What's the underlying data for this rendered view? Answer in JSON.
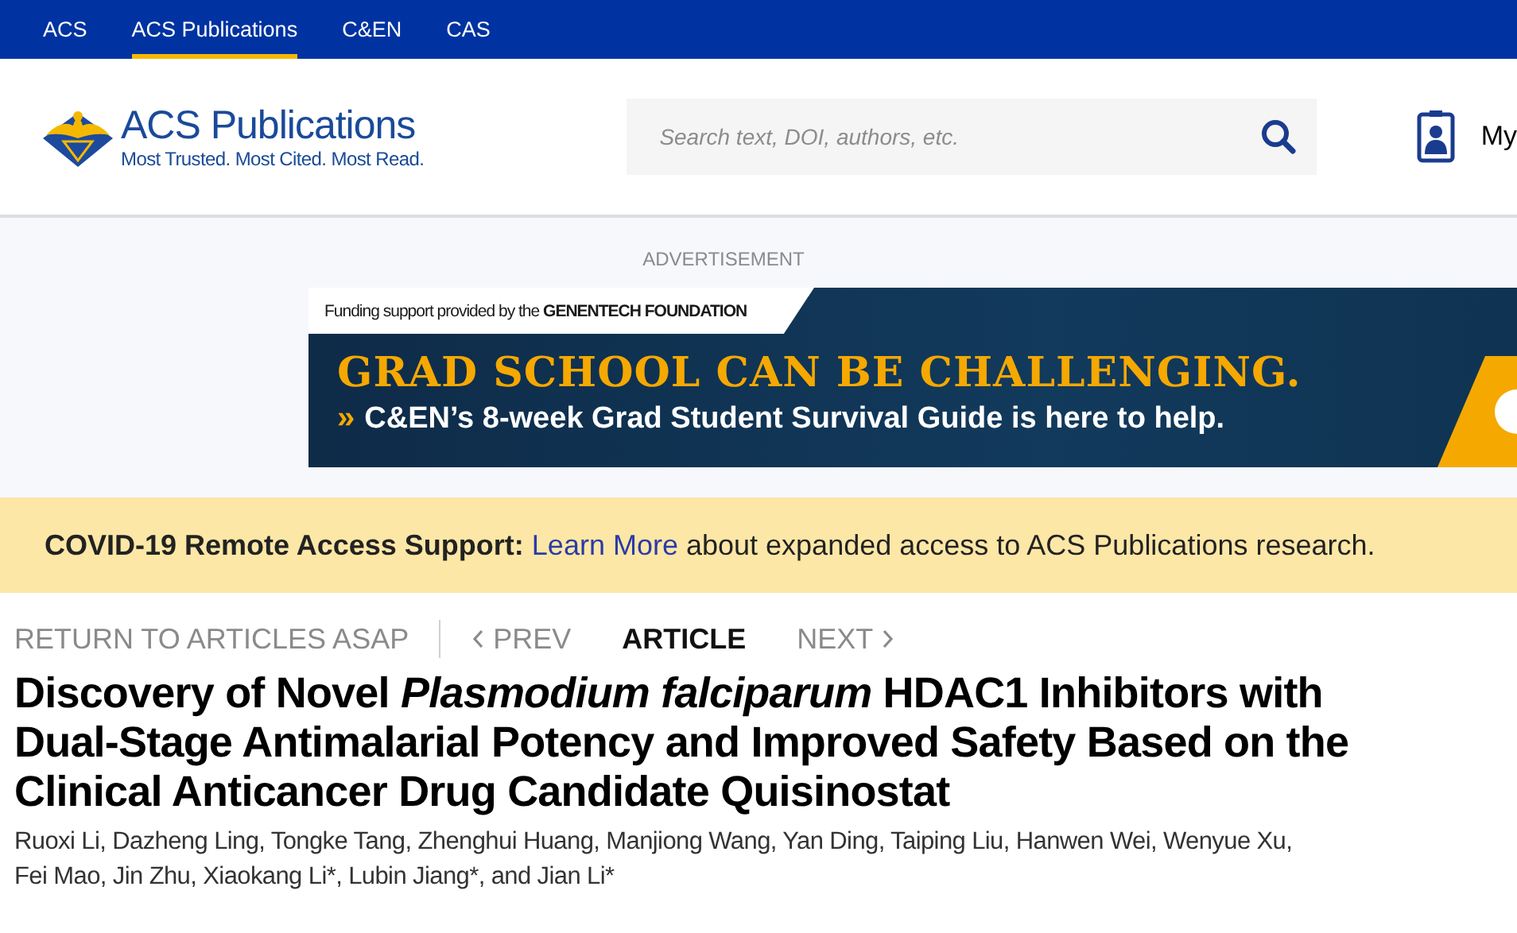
{
  "top_nav": [
    {
      "label": "ACS",
      "selected": false
    },
    {
      "label": "ACS Publications",
      "selected": true
    },
    {
      "label": "C&EN",
      "selected": false
    },
    {
      "label": "CAS",
      "selected": false
    }
  ],
  "header": {
    "logo_name": "ACS Publications",
    "logo_tagline": "Most Trusted. Most Cited. Most Read.",
    "search": {
      "placeholder": "Search text, DOI, authors, etc."
    },
    "account_label": "My"
  },
  "advertisement": {
    "label": "ADVERTISEMENT",
    "funding": "Funding support provided by the **GENENTECH FOUNDATION**",
    "headline": "GRAD SCHOOL CAN BE CHALLENGING.",
    "chevron": "»",
    "subline": "C&EN’s 8-week Grad Student Survival Guide is here to help."
  },
  "notice": {
    "title": "COVID-19 Remote Access Support:",
    "link": "Learn More",
    "text": "about expanded access to ACS Publications research."
  },
  "article_nav": {
    "return": "RETURN TO ARTICLES ASAP",
    "prev": "PREV",
    "current": "ARTICLE",
    "next": "NEXT"
  },
  "article": {
    "title_lines": [
      "Discovery of Novel *Plasmodium falciparum* HDAC1 Inhibitors with",
      "Dual-Stage Antimalarial Potency and Improved Safety Based on the",
      "Clinical Anticancer Drug Candidate Quisinostat"
    ],
    "author_lines": [
      "Ruoxi Li, Dazheng Ling, Tongke Tang, Zhenghui Huang, Manjiong Wang, Yan Ding, Taiping Liu, Hanwen Wei, Wenyue Xu,",
      "Fei Mao, Jin Zhu, Xiaokang Li*, Lubin Jiang*, and Jian Li*"
    ]
  }
}
